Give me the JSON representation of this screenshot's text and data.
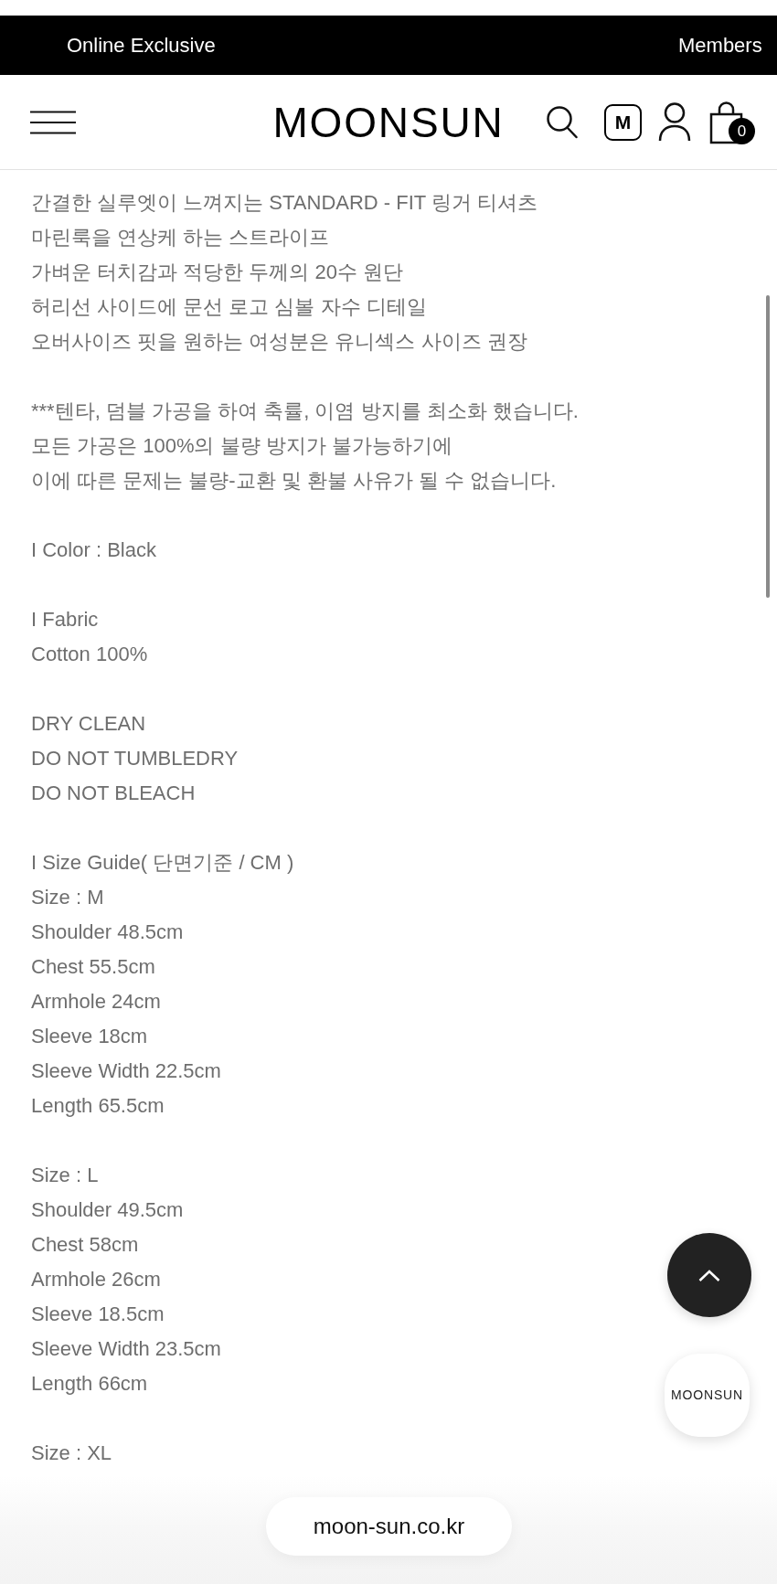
{
  "announcement_bar": {
    "messages": [
      "Online Exclusive",
      "Members"
    ]
  },
  "header": {
    "logo": "MOONSUN",
    "member_badge": "M",
    "cart_count": "0"
  },
  "description": {
    "paragraphs": [
      [
        "간결한 실루엣이 느껴지는 STANDARD - FIT 링거 티셔츠",
        "마린룩을 연상케 하는 스트라이프",
        "가벼운 터치감과 적당한 두께의 20수 원단",
        "허리선 사이드에 문선 로고 심볼 자수 디테일",
        "오버사이즈 핏을 원하는 여성분은 유니섹스 사이즈 권장"
      ],
      [
        "***텐타, 덤블 가공을 하여 축률, 이염 방지를 최소화 했습니다.",
        "모든 가공은 100%의 불량 방지가 불가능하기에",
        "이에 따른 문제는 불량-교환 및 환불 사유가 될 수 없습니다."
      ],
      [
        "I Color : Black"
      ],
      [
        "I Fabric",
        "Cotton 100%"
      ],
      [
        "DRY CLEAN",
        "DO NOT TUMBLEDRY",
        "DO NOT BLEACH"
      ],
      [
        "I Size Guide( 단면기준 / CM )",
        "Size : M",
        "Shoulder 48.5cm",
        "Chest 55.5cm",
        "Armhole 24cm",
        "Sleeve 18cm",
        "Sleeve Width 22.5cm",
        "Length 65.5cm"
      ],
      [
        "Size : L",
        "Shoulder 49.5cm",
        "Chest 58cm",
        "Armhole 26cm",
        "Sleeve 18.5cm",
        "Sleeve Width 23.5cm",
        "Length 66cm"
      ],
      [
        "Size : XL"
      ]
    ]
  },
  "floating_buttons": {
    "brand_button": "MOONSUN"
  },
  "address_bar": {
    "url": "moon-sun.co.kr"
  }
}
